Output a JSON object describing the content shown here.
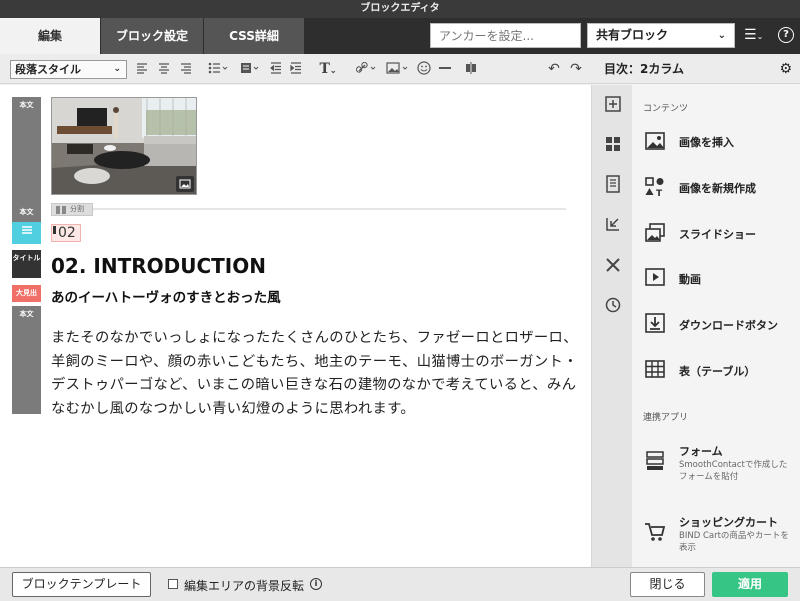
{
  "window": {
    "title": "ブロックエディタ"
  },
  "tabs": {
    "edit": "編集",
    "block_settings": "ブロック設定",
    "css": "CSS詳細"
  },
  "anchor_input": {
    "placeholder": "アンカーを設定..."
  },
  "shared_block": {
    "value": "共有ブロック"
  },
  "toolbar": {
    "paragraph_style": "段落スタイル"
  },
  "editor": {
    "labels": {
      "body": "本文",
      "title": "タイトル",
      "heading": "大見出"
    },
    "divider_label": "分割",
    "anchor_tag": "02",
    "title": "02. INTRODUCTION",
    "subtitle": "あのイーハトーヴォのすきとおった風",
    "paragraph": "またそのなかでいっしょになったたくさんのひとたち、ファゼーロとロザーロ、羊飼のミーロや、顔の赤いこどもたち、地主のテーモ、山猫博士のボーガント・デストゥパーゴなど、いまこの暗い巨きな石の建物のなかで考えていると、みんなむかし風のなつかしい青い幻燈のように思われます。"
  },
  "right_panel": {
    "title": "目次：2カラム",
    "contents_section": "コンテンツ",
    "items": [
      {
        "label": "画像を挿入"
      },
      {
        "label": "画像を新規作成"
      },
      {
        "label": "スライドショー"
      },
      {
        "label": "動画"
      },
      {
        "label": "ダウンロードボタン"
      },
      {
        "label": "表（テーブル）"
      }
    ],
    "apps_section": "連携アプリ",
    "apps": [
      {
        "label": "フォーム",
        "desc": "SmoothContactで作成したフォームを貼付"
      },
      {
        "label": "ショッピングカート",
        "desc": "BIND Cartの商品やカートを表示"
      }
    ]
  },
  "footer": {
    "template_button": "ブロックテンプレート",
    "invert_label": "編集エリアの背景反転",
    "close_button": "閉じる",
    "apply_button": "適用"
  },
  "colors": {
    "apply": "#37c586",
    "label_dark": "#7b7b7b",
    "label_cyan": "#4fcfe0",
    "label_red": "#f07068"
  }
}
